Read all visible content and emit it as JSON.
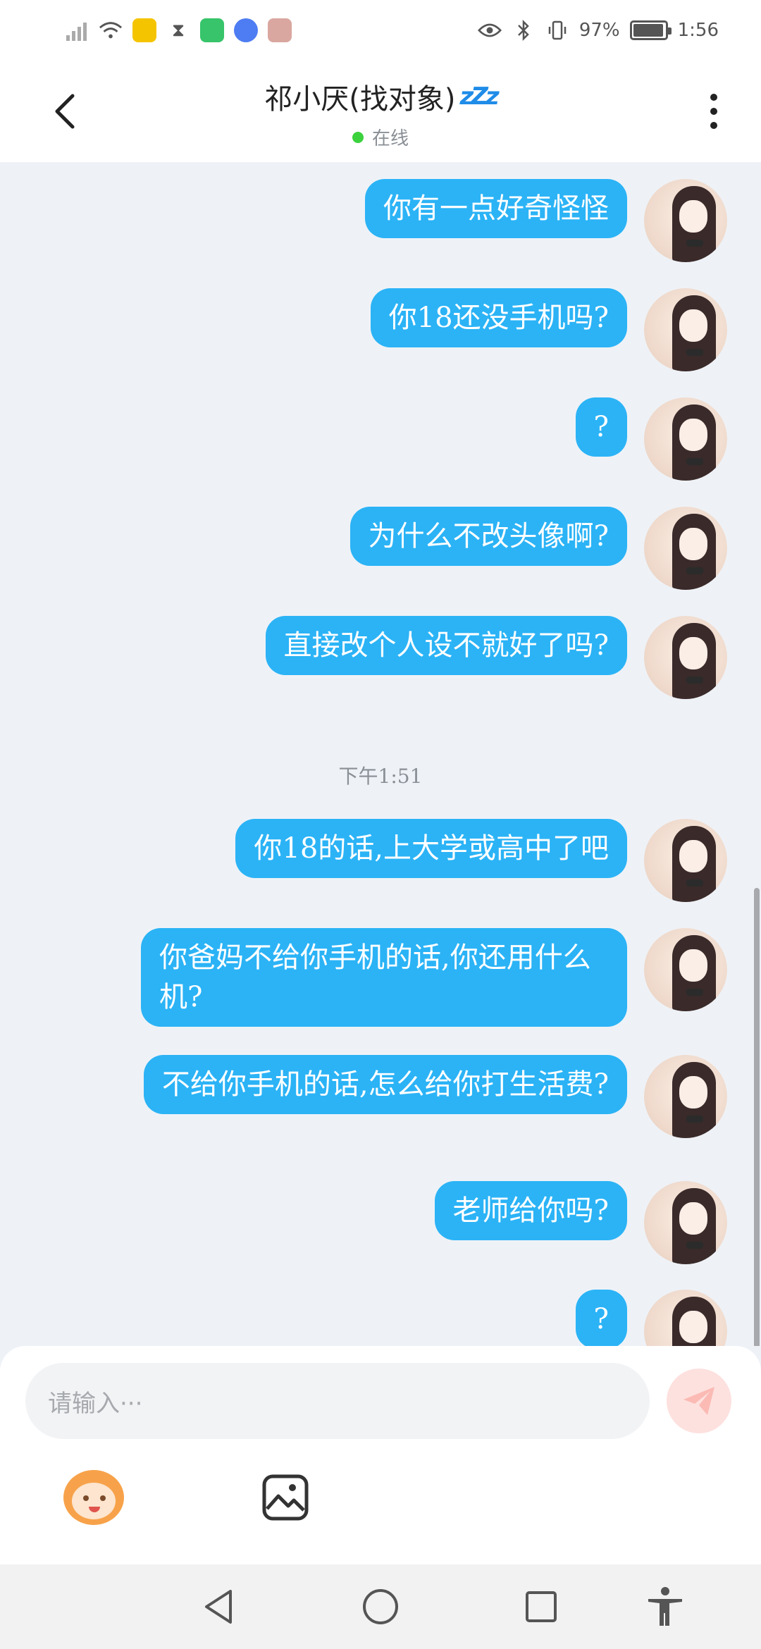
{
  "statusbar": {
    "battery_text": "97%",
    "battery_level": 0.97,
    "time": "1:56"
  },
  "header": {
    "title": "祁小厌(找对象)",
    "sleep_badge": "zZz",
    "status": "在线"
  },
  "messages": [
    {
      "text": "你有一点好奇怪怪"
    },
    {
      "text": "你18还没手机吗?"
    },
    {
      "text": "?"
    },
    {
      "text": "为什么不改头像啊?"
    },
    {
      "text": "直接改个人设不就好了吗?"
    },
    {
      "text": "你18的话,上大学或高中了吧"
    },
    {
      "text": "你爸妈不给你手机的话,你还用什么机?"
    },
    {
      "text": "不给你手机的话,怎么给你打生活费?"
    },
    {
      "text": "老师给你吗?"
    },
    {
      "text": "?"
    }
  ],
  "time_divider": "下午1:51",
  "input": {
    "placeholder": "请输入···"
  },
  "colors": {
    "bubble": "#2bb3f6",
    "online": "#3bd23d",
    "send_disabled": "#fde1df",
    "background": "#eef2f7"
  },
  "icons": {
    "back": "chevron-left-icon",
    "more": "more-vertical-icon",
    "send": "paper-plane-icon",
    "emoji": "monkey-emoji-icon",
    "image": "image-icon"
  }
}
